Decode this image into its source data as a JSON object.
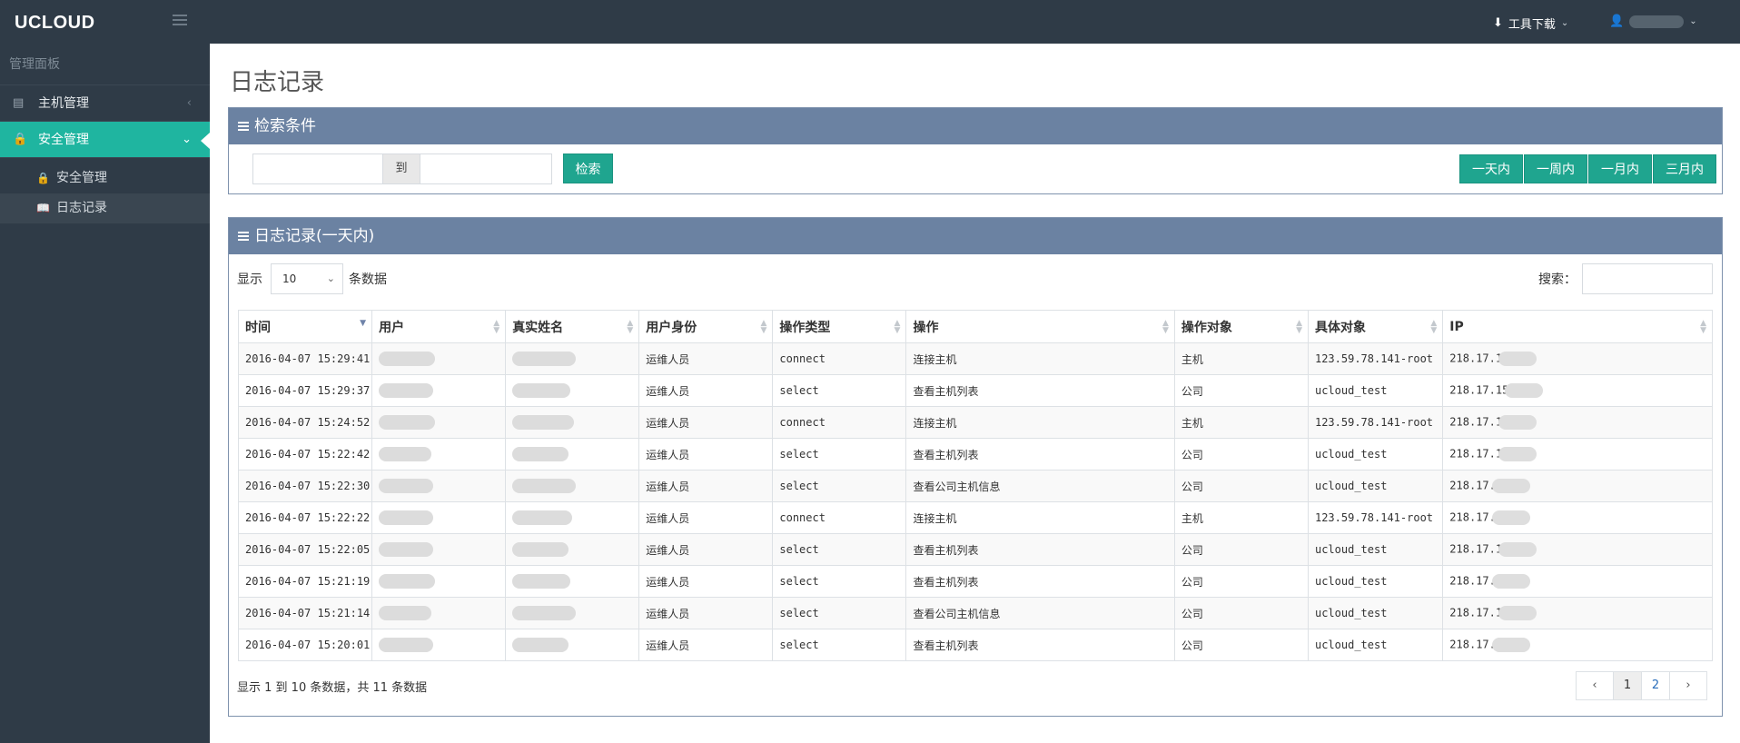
{
  "topbar": {
    "logo": "UCLOUD",
    "tools_label": "工具下载",
    "icons": {
      "tools": "download-icon",
      "user": "user-icon",
      "menu": "hamburger-icon"
    }
  },
  "sidebar": {
    "header": "管理面板",
    "items": [
      {
        "label": "主机管理",
        "icon": "server-icon",
        "active": false
      },
      {
        "label": "安全管理",
        "icon": "lock-icon",
        "active": true
      }
    ],
    "subitems": [
      {
        "label": "安全管理",
        "icon": "lock-icon",
        "selected": false
      },
      {
        "label": "日志记录",
        "icon": "book-icon",
        "selected": true
      }
    ]
  },
  "page": {
    "title": "日志记录"
  },
  "search_panel": {
    "title": "检索条件",
    "date_from": "",
    "to_label": "到",
    "date_to": "",
    "search_button": "检索",
    "ranges": [
      "一天内",
      "一周内",
      "一月内",
      "三月内"
    ]
  },
  "log_panel": {
    "title": "日志记录(一天内)",
    "show_label": "显示",
    "page_length": "10",
    "rows_label": "条数据",
    "search_label": "搜索：",
    "search_value": "",
    "columns": [
      "时间",
      "用户",
      "真实姓名",
      "用户身份",
      "操作类型",
      "操作",
      "操作对象",
      "具体对象",
      "IP"
    ],
    "rows": [
      {
        "time": "2016-04-07 15:29:41",
        "role": "运维人员",
        "op_type": "connect",
        "op": "连接主机",
        "target": "主机",
        "detail": "123.59.78.141-root",
        "ip": "218.17.1"
      },
      {
        "time": "2016-04-07 15:29:37",
        "role": "运维人员",
        "op_type": "select",
        "op": "查看主机列表",
        "target": "公司",
        "detail": "ucloud_test",
        "ip": "218.17.15"
      },
      {
        "time": "2016-04-07 15:24:52",
        "role": "运维人员",
        "op_type": "connect",
        "op": "连接主机",
        "target": "主机",
        "detail": "123.59.78.141-root",
        "ip": "218.17.1"
      },
      {
        "time": "2016-04-07 15:22:42",
        "role": "运维人员",
        "op_type": "select",
        "op": "查看主机列表",
        "target": "公司",
        "detail": "ucloud_test",
        "ip": "218.17.1"
      },
      {
        "time": "2016-04-07 15:22:30",
        "role": "运维人员",
        "op_type": "select",
        "op": "查看公司主机信息",
        "target": "公司",
        "detail": "ucloud_test",
        "ip": "218.17."
      },
      {
        "time": "2016-04-07 15:22:22",
        "role": "运维人员",
        "op_type": "connect",
        "op": "连接主机",
        "target": "主机",
        "detail": "123.59.78.141-root",
        "ip": "218.17."
      },
      {
        "time": "2016-04-07 15:22:05",
        "role": "运维人员",
        "op_type": "select",
        "op": "查看主机列表",
        "target": "公司",
        "detail": "ucloud_test",
        "ip": "218.17.1"
      },
      {
        "time": "2016-04-07 15:21:19",
        "role": "运维人员",
        "op_type": "select",
        "op": "查看主机列表",
        "target": "公司",
        "detail": "ucloud_test",
        "ip": "218.17."
      },
      {
        "time": "2016-04-07 15:21:14",
        "role": "运维人员",
        "op_type": "select",
        "op": "查看公司主机信息",
        "target": "公司",
        "detail": "ucloud_test",
        "ip": "218.17.1"
      },
      {
        "time": "2016-04-07 15:20:01",
        "role": "运维人员",
        "op_type": "select",
        "op": "查看主机列表",
        "target": "公司",
        "detail": "ucloud_test",
        "ip": "218.17."
      }
    ],
    "info": "显示 1 到 10 条数据，共 11 条数据",
    "pager": {
      "prev": "‹",
      "pages": [
        "1",
        "2"
      ],
      "current": "1",
      "next": "›"
    }
  }
}
